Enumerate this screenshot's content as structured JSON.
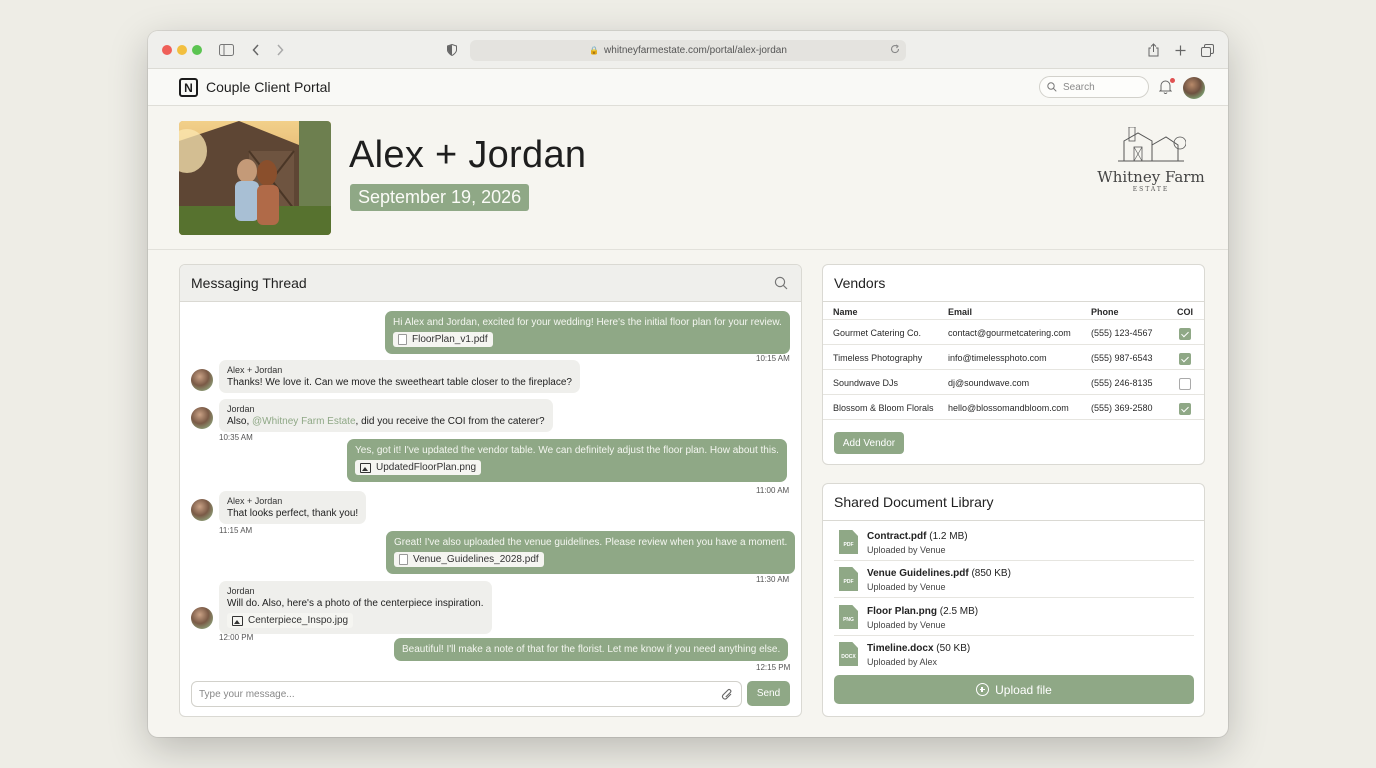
{
  "browser": {
    "url": "whitneyfarmestate.com/portal/alex-jordan"
  },
  "header": {
    "logo_letter": "N",
    "title": "Couple Client Portal",
    "search_placeholder": "Search"
  },
  "hero": {
    "couple_name": "Alex + Jordan",
    "wedding_date": "September 19, 2026",
    "venue_name": "Whitney Farm",
    "venue_sub": "ESTATE"
  },
  "messaging": {
    "title": "Messaging Thread",
    "messages": [
      {
        "text": "Hi Alex and Jordan, excited for your wedding! Here's the initial floor plan for your review.",
        "attachment": "FloorPlan_v1.pdf",
        "time": "10:15 AM"
      },
      {
        "sender": "Alex + Jordan",
        "text": "Thanks! We love it. Can we move the sweetheart table closer to the fireplace?"
      },
      {
        "sender": "Jordan",
        "text_before": "Also, ",
        "mention": "@Whitney Farm Estate",
        "text_after": ", did you receive the COI from the caterer?",
        "time": "10:35 AM"
      },
      {
        "text": "Yes, got it! I've updated the vendor table. We can definitely adjust the floor plan. How about this.",
        "attachment": "UpdatedFloorPlan.png",
        "time": "11:00 AM"
      },
      {
        "sender": "Alex + Jordan",
        "text": "That looks perfect, thank you!",
        "time": "11:15 AM"
      },
      {
        "text": "Great! I've also uploaded the venue guidelines. Please review when you have a moment.",
        "attachment": "Venue_Guidelines_2028.pdf",
        "time": "11:30 AM"
      },
      {
        "sender": "Jordan",
        "text": "Will do. Also, here's a photo of the centerpiece inspiration.",
        "attachment": "Centerpiece_Inspo.jpg",
        "time": "12:00 PM"
      },
      {
        "text": "Beautiful! I'll make a note of that for the florist. Let me know if you need anything else.",
        "time": "12:15 PM"
      }
    ],
    "input_placeholder": "Type your message...",
    "send_label": "Send"
  },
  "vendors": {
    "title": "Vendors",
    "columns": [
      "Name",
      "Email",
      "Phone",
      "COI"
    ],
    "rows": [
      {
        "name": "Gourmet Catering Co.",
        "email": "contact@gourmetcatering.com",
        "phone": "(555) 123-4567",
        "coi": true
      },
      {
        "name": "Timeless Photography",
        "email": "info@timelessphoto.com",
        "phone": "(555) 987-6543",
        "coi": true
      },
      {
        "name": "Soundwave DJs",
        "email": "dj@soundwave.com",
        "phone": "(555) 246-8135",
        "coi": false
      },
      {
        "name": "Blossom & Bloom Florals",
        "email": "hello@blossomandbloom.com",
        "phone": "(555) 369-2580",
        "coi": true
      }
    ],
    "add_label": "Add Vendor"
  },
  "documents": {
    "title": "Shared Document Library",
    "items": [
      {
        "type": "PDF",
        "name": "Contract.pdf",
        "size": "(1.2 MB)",
        "by": "Uploaded by Venue"
      },
      {
        "type": "PDF",
        "name": "Venue Guidelines.pdf",
        "size": "(850 KB)",
        "by": "Uploaded by Venue"
      },
      {
        "type": "PNG",
        "name": "Floor Plan.png",
        "size": "(2.5 MB)",
        "by": "Uploaded by Venue"
      },
      {
        "type": "DOCX",
        "name": "Timeline.docx",
        "size": "(50 KB)",
        "by": "Uploaded by Alex"
      }
    ],
    "upload_label": "Upload file"
  },
  "colors": {
    "accent": "#8fa886",
    "background": "#eeede6"
  }
}
